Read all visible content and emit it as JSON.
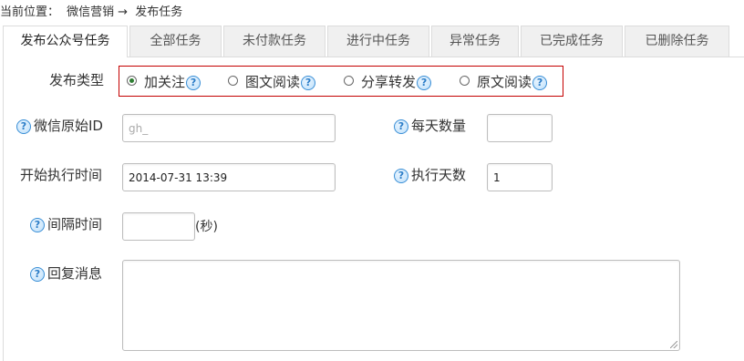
{
  "breadcrumb": {
    "prefix": "当前位置：",
    "section": "微信营销",
    "arrow": "→",
    "current": "发布任务"
  },
  "tabs": [
    {
      "label": "发布公众号任务",
      "active": true
    },
    {
      "label": "全部任务",
      "active": false
    },
    {
      "label": "未付款任务",
      "active": false
    },
    {
      "label": "进行中任务",
      "active": false
    },
    {
      "label": "异常任务",
      "active": false
    },
    {
      "label": "已完成任务",
      "active": false
    },
    {
      "label": "已删除任务",
      "active": false
    }
  ],
  "form": {
    "type_label": "发布类型",
    "types": [
      {
        "label": "加关注",
        "checked": true
      },
      {
        "label": "图文阅读",
        "checked": false
      },
      {
        "label": "分享转发",
        "checked": false
      },
      {
        "label": "原文阅读",
        "checked": false
      }
    ],
    "wechat_id_label": "微信原始ID",
    "wechat_id_value": "",
    "wechat_id_placeholder": "gh_",
    "daily_count_label": "每天数量",
    "daily_count_value": "",
    "start_time_label": "开始执行时间",
    "start_time_value": "2014-07-31 13:39",
    "days_label": "执行天数",
    "days_value": "1",
    "interval_label": "间隔时间",
    "interval_value": "",
    "interval_unit": "(秒)",
    "reply_label": "回复消息",
    "reply_value": ""
  },
  "icons": {
    "help": "question-circle-icon",
    "radio_checked_color": "#2e7d32",
    "help_color": "#3a8fd6",
    "highlight_border": "#c40000"
  }
}
